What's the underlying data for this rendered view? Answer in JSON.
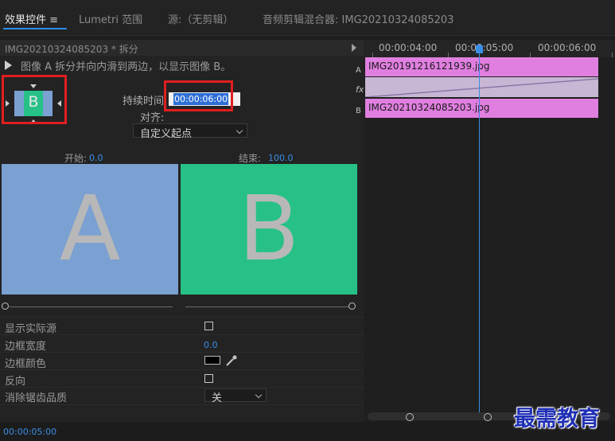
{
  "tabs": {
    "effects": "效果控件",
    "effects_menu_icon": "hamburger-icon",
    "lumetri": "Lumetri 范围",
    "source": "源:（无剪辑）",
    "mixer": "音频剪辑混合器: IMG20210324085203"
  },
  "clip_header": {
    "title": "IMG20210324085203 * 拆分"
  },
  "description": "图像 A 拆分并向内滑到两边，以显示图像 B。",
  "thumbnail": {
    "label": "B"
  },
  "duration": {
    "label": "持续时间",
    "value": "00:00:06:00"
  },
  "alignment": {
    "label": "对齐:",
    "value": "自定义起点"
  },
  "start": {
    "label": "开始:",
    "value": "0.0"
  },
  "end": {
    "label": "结束:",
    "value": "100.0"
  },
  "preview": {
    "a_label": "A",
    "b_label": "B"
  },
  "properties": {
    "show_actual_sources": {
      "label": "显示实际源",
      "checked": false
    },
    "border_width": {
      "label": "边框宽度",
      "value": "0.0"
    },
    "border_color": {
      "label": "边框颜色",
      "color": "#000000"
    },
    "reverse": {
      "label": "反向",
      "checked": false
    },
    "anti_aliasing": {
      "label": "消除锯齿品质",
      "value": "关"
    }
  },
  "bottom_timecode": "00:00:05:00",
  "timeline": {
    "ruler": [
      "00:00:04:00",
      "00:00:05:00",
      "00:00:06:00"
    ],
    "track_a_clip": "IMG20191216121939.jpg",
    "track_b_clip": "IMG20210324085203.jpg",
    "side_a": "A",
    "side_fx": "fx",
    "side_b": "B"
  },
  "colors": {
    "accent": "#2d8ceb",
    "clip": "#e07fe0",
    "image_a": "#7ba0d2",
    "image_b": "#27c187",
    "highlight": "#e01e1e"
  },
  "watermark": "最需教育"
}
